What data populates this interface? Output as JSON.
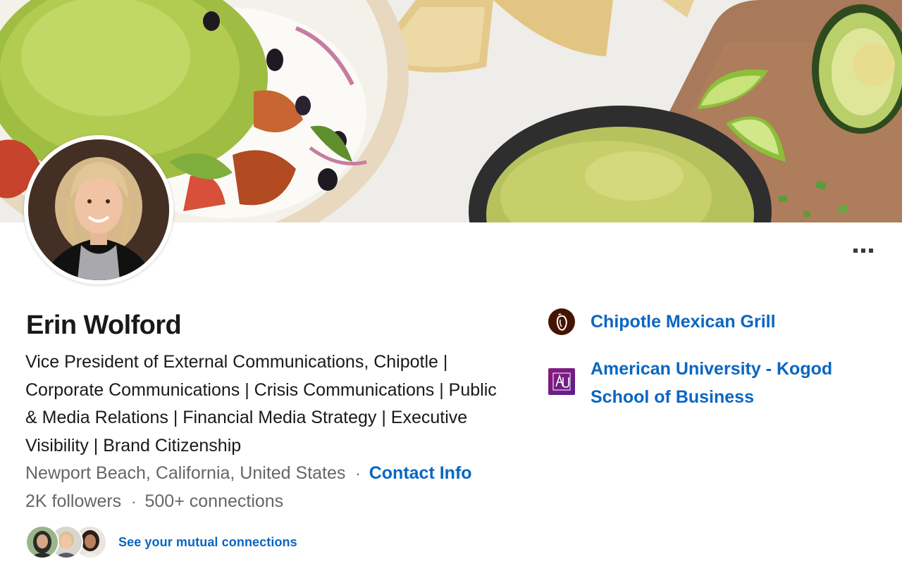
{
  "profile": {
    "name": "Erin Wolford",
    "headline": "Vice President of External Communications, Chipotle | Corporate Communications | Crisis Communications | Public & Media Relations | Financial Media Strategy | Executive Visibility | Brand Citizenship",
    "location": "Newport Beach, California, United States",
    "separator": "·",
    "contact_info_label": "Contact Info",
    "followers": "2K followers",
    "connections": "500+ connections",
    "mutual_connections_label": "See your mutual connections"
  },
  "organizations": {
    "company": {
      "label": "Chipotle Mexican Grill",
      "icon": "chipotle-logo-icon"
    },
    "school": {
      "label": "American University - Kogod School of Business",
      "icon": "american-university-logo-icon"
    }
  },
  "actions": {
    "more_icon": "more-options-icon"
  },
  "colors": {
    "link": "#0a66c2",
    "primary_text": "#191919",
    "secondary_text": "#666666",
    "chipotle_brown": "#451400",
    "school_purple": "#7a1c84"
  }
}
